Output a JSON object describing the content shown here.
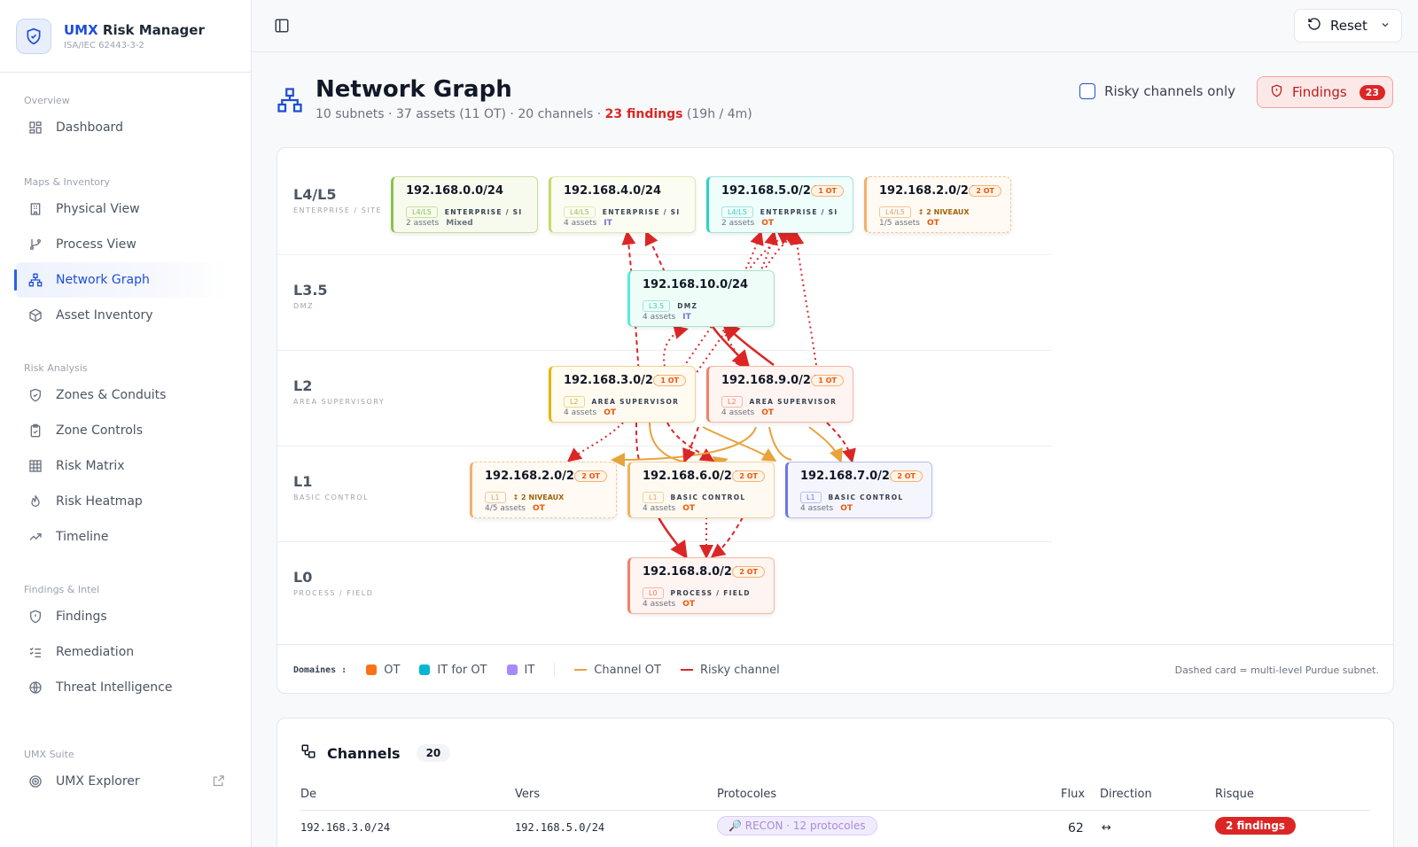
{
  "app": {
    "name_bold": "UMX",
    "name_rest": " Risk Manager",
    "subtitle": "ISA/IEC 62443-3-2"
  },
  "nav": {
    "groups": [
      {
        "title": "Overview",
        "items": [
          {
            "label": "Dashboard",
            "icon": "dashboard-icon"
          }
        ]
      },
      {
        "title": "Maps & Inventory",
        "items": [
          {
            "label": "Physical View",
            "icon": "building-icon"
          },
          {
            "label": "Process View",
            "icon": "git-branch-icon"
          },
          {
            "label": "Network Graph",
            "icon": "network-icon",
            "active": true
          },
          {
            "label": "Asset Inventory",
            "icon": "box-icon"
          }
        ]
      },
      {
        "title": "Risk Analysis",
        "items": [
          {
            "label": "Zones & Conduits",
            "icon": "shield-icon"
          },
          {
            "label": "Zone Controls",
            "icon": "clipboard-icon"
          },
          {
            "label": "Risk Matrix",
            "icon": "grid-icon"
          },
          {
            "label": "Risk Heatmap",
            "icon": "flame-icon"
          },
          {
            "label": "Timeline",
            "icon": "trend-icon"
          }
        ]
      },
      {
        "title": "Findings & Intel",
        "items": [
          {
            "label": "Findings",
            "icon": "shield-alert-icon"
          },
          {
            "label": "Remediation",
            "icon": "list-check-icon"
          },
          {
            "label": "Threat Intelligence",
            "icon": "globe-icon"
          }
        ]
      },
      {
        "title": "UMX Suite",
        "items": [
          {
            "label": "UMX Explorer",
            "icon": "radar-icon"
          }
        ]
      }
    ]
  },
  "topbar": {
    "reset_label": "Reset"
  },
  "header": {
    "title": "Network Graph",
    "stats": "10 subnets · 37 assets (11 OT) · 20 channels · ",
    "findings_text": "23 findings",
    "findings_detail": " (19h / 4m)",
    "risky_label": "Risky channels only",
    "findings_button": "Findings",
    "findings_count": "23"
  },
  "lanes": [
    {
      "code": "L4/L5",
      "name": "Enterprise / Site"
    },
    {
      "code": "L3.5",
      "name": "DMZ"
    },
    {
      "code": "L2",
      "name": "Area Supervisory"
    },
    {
      "code": "L1",
      "name": "Basic Control"
    },
    {
      "code": "L0",
      "name": "Process / Field"
    }
  ],
  "nodes": [
    {
      "ip": "192.168.0.0/24",
      "ot": "",
      "tag": "L4/L5",
      "zone": "ENTERPRISE / SI",
      "assets": "2 assets",
      "domain": "Mixed"
    },
    {
      "ip": "192.168.4.0/24",
      "ot": "",
      "tag": "L4/L5",
      "zone": "ENTERPRISE / SI",
      "assets": "4 assets",
      "domain": "IT"
    },
    {
      "ip": "192.168.5.0/24",
      "ot": "1 OT",
      "tag": "L4/L5",
      "zone": "ENTERPRISE / SI",
      "assets": "2 assets",
      "domain": "OT"
    },
    {
      "ip": "192.168.2.0/24",
      "ot": "2 OT",
      "tag": "L4/L5",
      "zone": "↕ 2 NIVEAUX",
      "assets": "1/5 assets",
      "domain": "OT"
    },
    {
      "ip": "192.168.10.0/24",
      "ot": "",
      "tag": "L3.5",
      "zone": "DMZ",
      "assets": "4 assets",
      "domain": "IT"
    },
    {
      "ip": "192.168.3.0/24",
      "ot": "1 OT",
      "tag": "L2",
      "zone": "AREA SUPERVISOR",
      "assets": "4 assets",
      "domain": "OT"
    },
    {
      "ip": "192.168.9.0/24",
      "ot": "1 OT",
      "tag": "L2",
      "zone": "AREA SUPERVISOR",
      "assets": "4 assets",
      "domain": "OT"
    },
    {
      "ip": "192.168.2.0/24",
      "ot": "2 OT",
      "tag": "L1",
      "zone": "↕ 2 NIVEAUX",
      "assets": "4/5 assets",
      "domain": "OT"
    },
    {
      "ip": "192.168.6.0/24",
      "ot": "2 OT",
      "tag": "L1",
      "zone": "BASIC CONTROL",
      "assets": "4 assets",
      "domain": "OT"
    },
    {
      "ip": "192.168.7.0/24",
      "ot": "2 OT",
      "tag": "L1",
      "zone": "BASIC CONTROL",
      "assets": "4 assets",
      "domain": "OT"
    },
    {
      "ip": "192.168.8.0/24",
      "ot": "2 OT",
      "tag": "L0",
      "zone": "PROCESS / FIELD",
      "assets": "4 assets",
      "domain": "OT"
    }
  ],
  "legend": {
    "title": "Domaines :",
    "items": [
      "OT",
      "IT for OT",
      "IT"
    ],
    "channel_ot": "Channel OT",
    "risky_channel": "Risky channel",
    "note": "Dashed card = multi-level Purdue subnet."
  },
  "colors": {
    "ot": "#f97316",
    "it_for_ot": "#06b6d4",
    "it": "#a78bfa",
    "risky": "#dc2626",
    "channel_ot": "#e8a33d",
    "accent": "#1d4ed8"
  },
  "channels": {
    "title": "Channels",
    "count": "20",
    "headers": [
      "De",
      "Vers",
      "Protocoles",
      "Flux",
      "Direction",
      "Risque"
    ],
    "rows": [
      {
        "from": "192.168.3.0/24",
        "to": "192.168.5.0/24",
        "protocols": "🔎 RECON · 12 protocoles",
        "flux": "62",
        "direction": "↔",
        "risk": "2 findings"
      }
    ]
  }
}
